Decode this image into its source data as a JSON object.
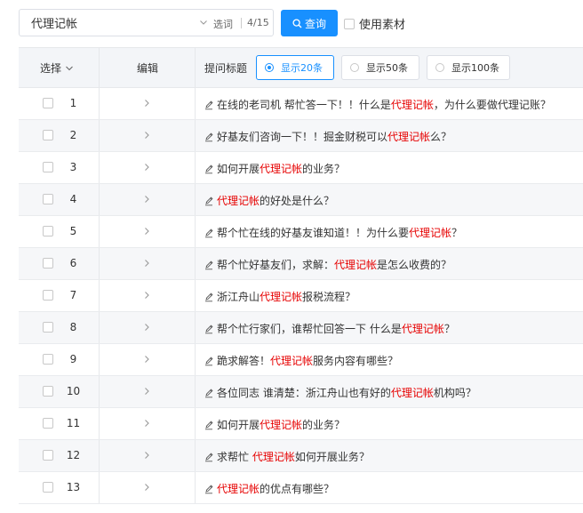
{
  "search": {
    "value": "代理记帐",
    "select_label": "选词",
    "count": "4/15"
  },
  "query_button": {
    "label": "查询"
  },
  "material": {
    "label": "使用素材",
    "checked": false
  },
  "table": {
    "headers": {
      "select": "选择",
      "edit": "编辑",
      "title": "提问标题"
    },
    "display_options": [
      {
        "label": "显示20条",
        "active": true
      },
      {
        "label": "显示50条",
        "active": false
      },
      {
        "label": "显示100条",
        "active": false
      }
    ],
    "keyword": "代理记帐",
    "rows": [
      {
        "num": "1",
        "pre": "在线的老司机 帮忙答一下！！什么是",
        "post": "，为什么要做代理记账？"
      },
      {
        "num": "2",
        "pre": "好基友们咨询一下！！掘金财税可以",
        "post": "么？"
      },
      {
        "num": "3",
        "pre": "如何开展",
        "post": "的业务？"
      },
      {
        "num": "4",
        "pre": "",
        "post": "的好处是什么？"
      },
      {
        "num": "5",
        "pre": "帮个忙在线的好基友谁知道！！为什么要",
        "post": "？"
      },
      {
        "num": "6",
        "pre": "帮个忙好基友们，求解：",
        "post": "是怎么收费的？"
      },
      {
        "num": "7",
        "pre": "浙江舟山",
        "post": "报税流程？"
      },
      {
        "num": "8",
        "pre": "帮个忙行家们，谁帮忙回答一下 什么是",
        "post": "？"
      },
      {
        "num": "9",
        "pre": "跪求解答！",
        "post": "服务内容有哪些？"
      },
      {
        "num": "10",
        "pre": "各位同志 谁清楚：浙江舟山也有好的",
        "post": "机构吗？"
      },
      {
        "num": "11",
        "pre": "如何开展",
        "post": "的业务？"
      },
      {
        "num": "12",
        "pre": "求帮忙 ",
        "post": "如何开展业务？"
      },
      {
        "num": "13",
        "pre": "",
        "post": "的优点有哪些？"
      }
    ]
  },
  "colors": {
    "accent": "#1890ff",
    "keyword": "#e60000",
    "header_bg": "#f3f5f8"
  }
}
